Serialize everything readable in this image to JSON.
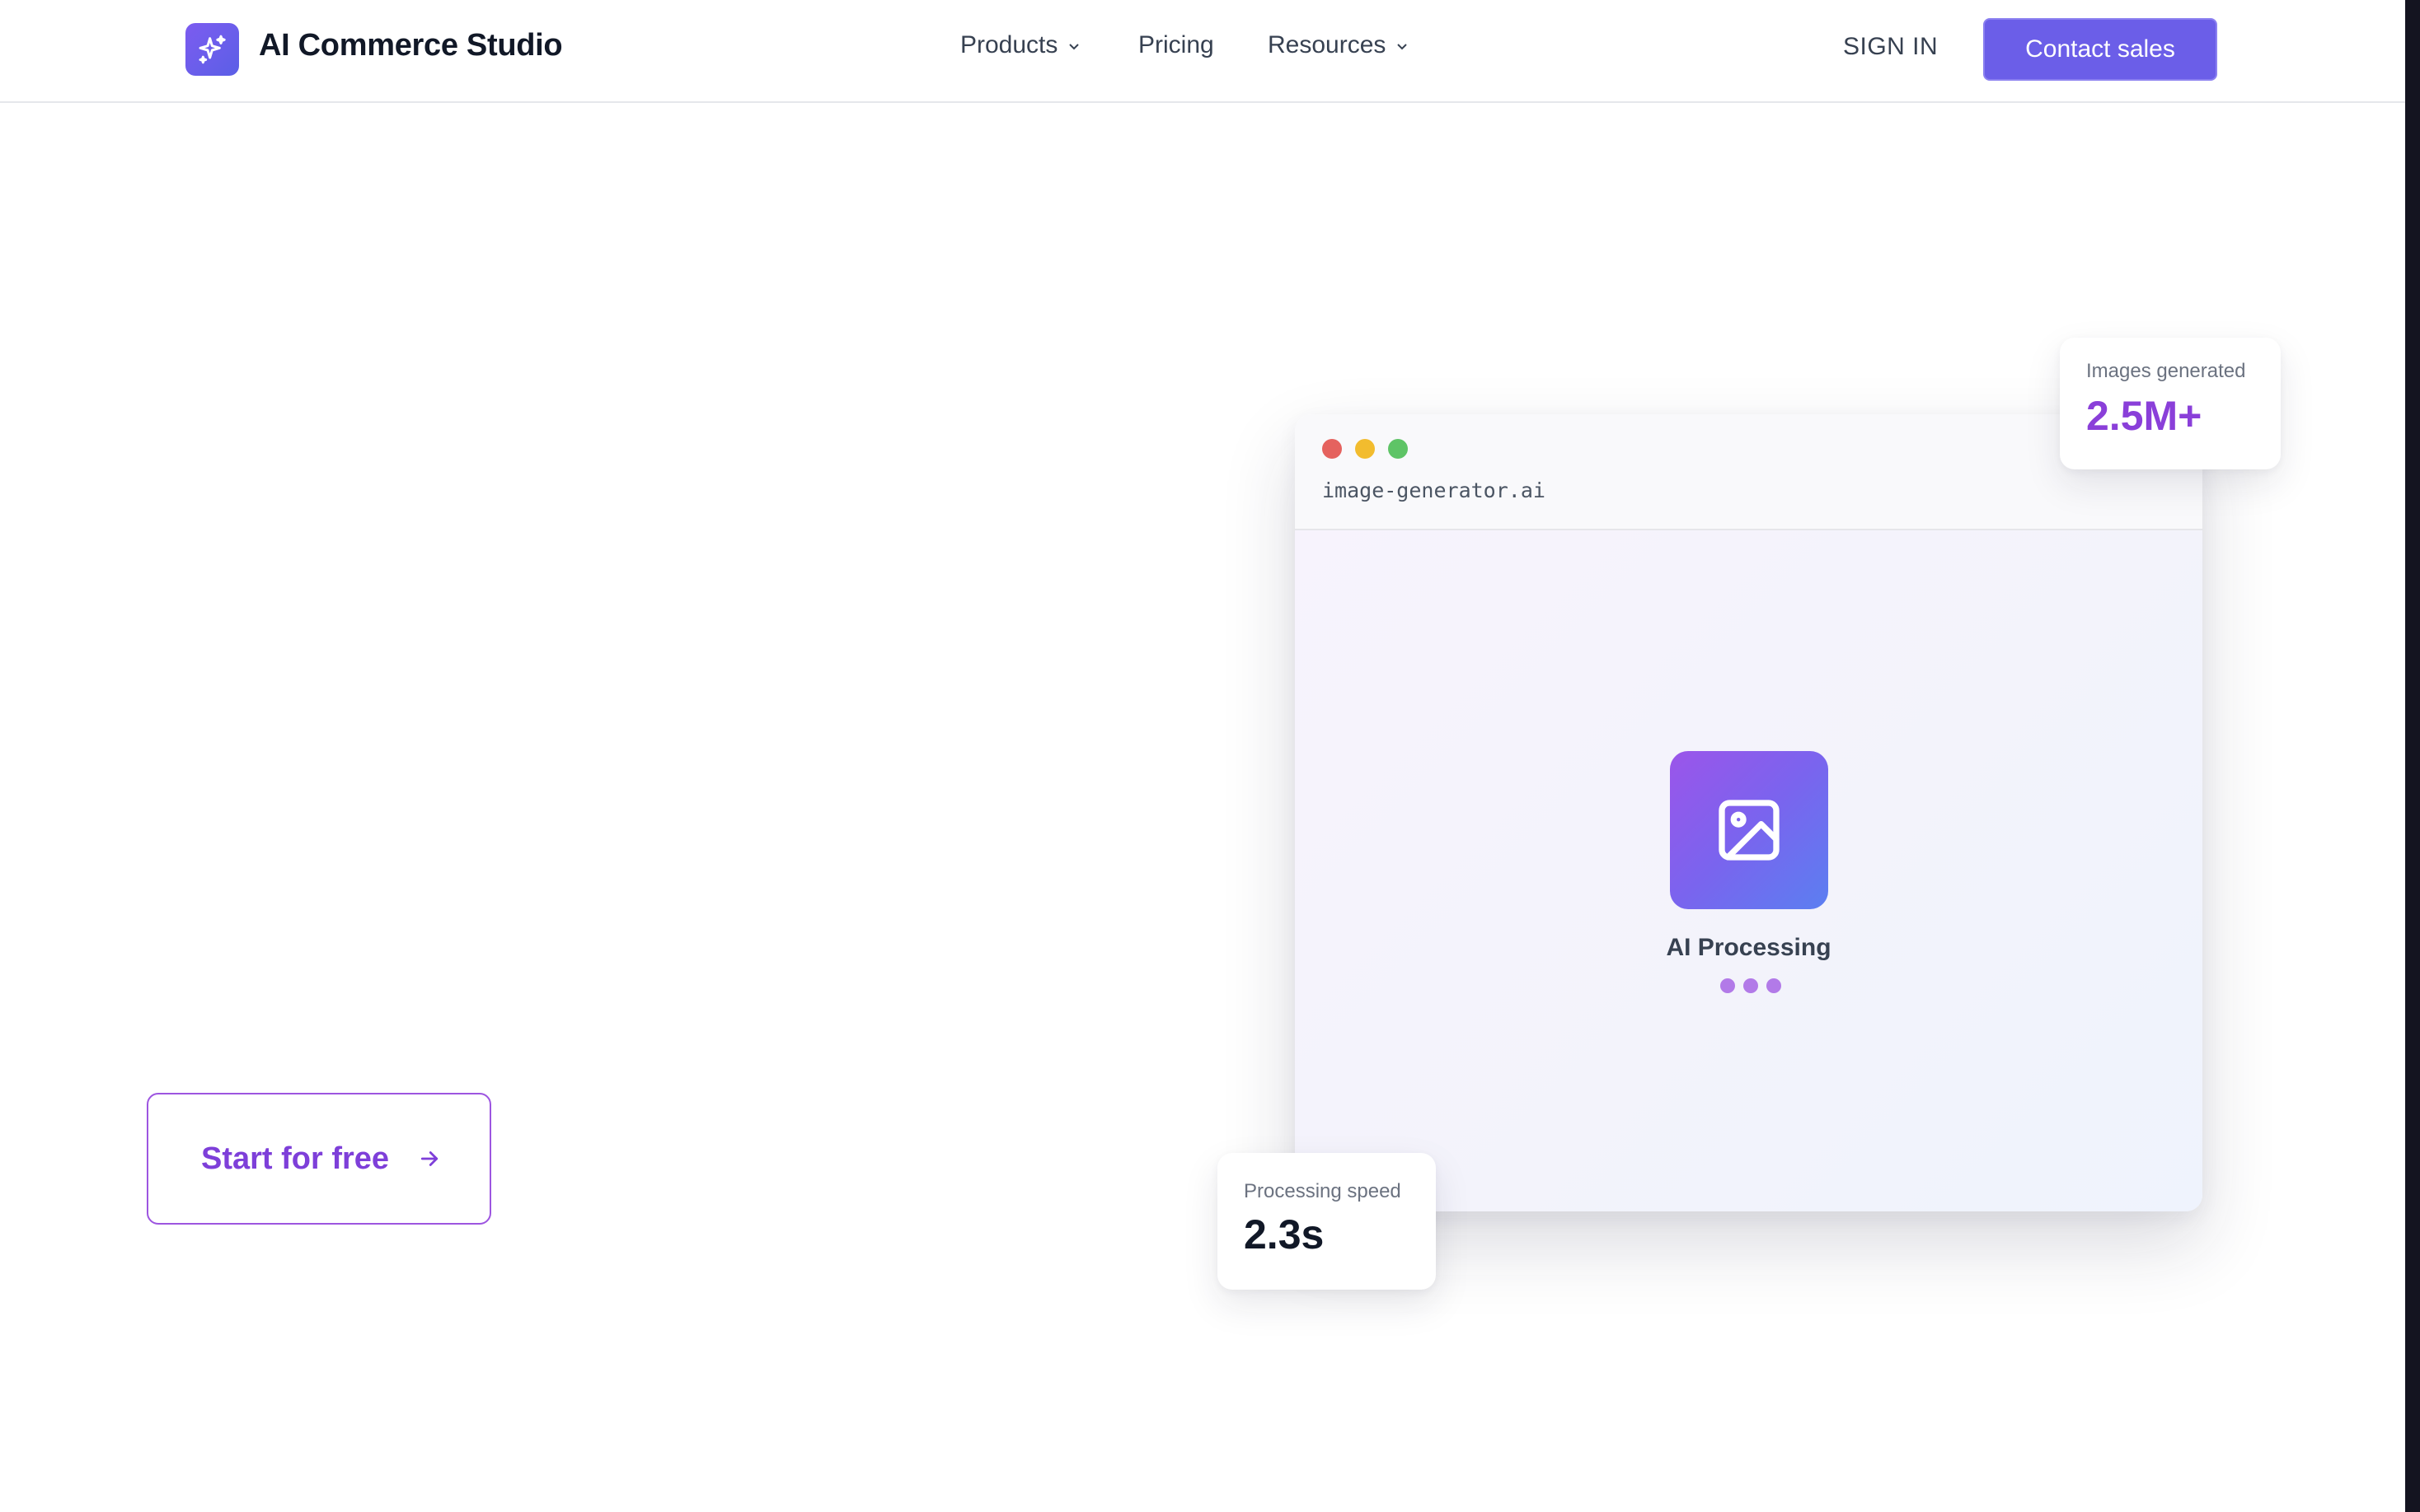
{
  "header": {
    "brand": "AI Commerce Studio",
    "nav": [
      {
        "label": "Products",
        "has_dropdown": true
      },
      {
        "label": "Pricing",
        "has_dropdown": false
      },
      {
        "label": "Resources",
        "has_dropdown": true
      }
    ],
    "sign_in": "SIGN IN",
    "contact": "Contact sales"
  },
  "hero": {
    "cta_label": "Start for free"
  },
  "mockup": {
    "url": "image-generator.ai",
    "status": "AI Processing",
    "window_dots": [
      "#e5625e",
      "#f2bc2e",
      "#5ec466"
    ]
  },
  "stats": {
    "images": {
      "label": "Images generated",
      "value": "2.5M+"
    },
    "speed": {
      "label": "Processing speed",
      "value": "2.3s"
    }
  },
  "colors": {
    "accent": "#6b5ee8",
    "purple": "#7e3fd9"
  }
}
